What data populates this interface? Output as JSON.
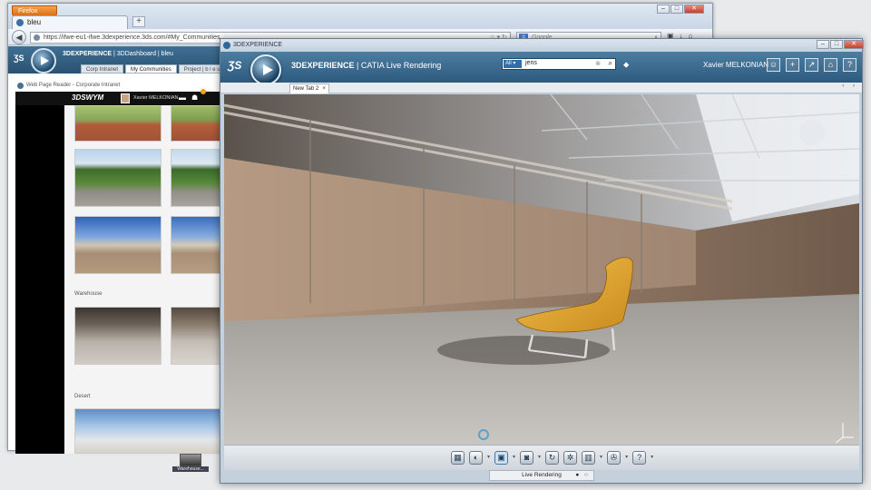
{
  "firefox": {
    "menu_label": "Firefox",
    "tab_title": "bleu",
    "new_tab_symbol": "+",
    "url": "https://ifwe-eu1-ifwe.3dexperience.3ds.com/#My_Communities",
    "search_placeholder": "Google",
    "window_controls": [
      "–",
      "□",
      "✕"
    ],
    "toolbar_icons": [
      "☆",
      "▾",
      "↻",
      "⌕",
      "▣",
      "▾",
      "↓",
      "⌂"
    ]
  },
  "dashboard": {
    "title_brand": "3DEXPERIENCE",
    "title_rest": " | 3DDashboard | bleu",
    "tabs": [
      "Corp Intranet",
      "My Communities",
      "Project | b l e u",
      "D"
    ],
    "active_tab": 1,
    "widget_title": "Web Page Reader - Corporate Intranet",
    "swym_logo": "3DSWYM",
    "swym_user": "Xavier MELKONIAN",
    "section_warehouse": "Warehouse",
    "section_desert": "Desert"
  },
  "app": {
    "window_title": "3DEXPERIENCE",
    "window_controls": [
      "–",
      "□",
      "✕"
    ],
    "brand": "3DEXPERIENCE",
    "app_name": " | CATIA Live Rendering",
    "search_scope": "All",
    "search_value": "jens",
    "user_name": "Xavier MELKONIAN",
    "header_icons": [
      "user-icon",
      "add-icon",
      "share-icon",
      "home-icon",
      "help-icon"
    ],
    "header_icon_glyphs": [
      "☺",
      "+",
      "↗",
      "⌂",
      "?"
    ],
    "tab_label": "New Tab 2",
    "tab_close": "×",
    "tab_nav": "‹ ›",
    "toolbar_icons": [
      "scene-icon",
      "material-icon",
      "environment-icon",
      "camera-icon",
      "render-icon",
      "settings-icon",
      "export-icon",
      "share-icon",
      "help-icon"
    ],
    "toolbar_glyphs": [
      "▦",
      "◐",
      "▣",
      "◙",
      "↻",
      "✲",
      "▥",
      "✇",
      "?"
    ],
    "status_label": "Live Rendering",
    "status_dots": "● ○"
  },
  "desktop": {
    "icon_label": "Warehouse..."
  },
  "colors": {
    "ds_blue": "#2d5a7e",
    "search_scope_blue": "#2f6ea8",
    "chair_yellow": "#e0a530",
    "firefox_orange": "#e8852a"
  }
}
